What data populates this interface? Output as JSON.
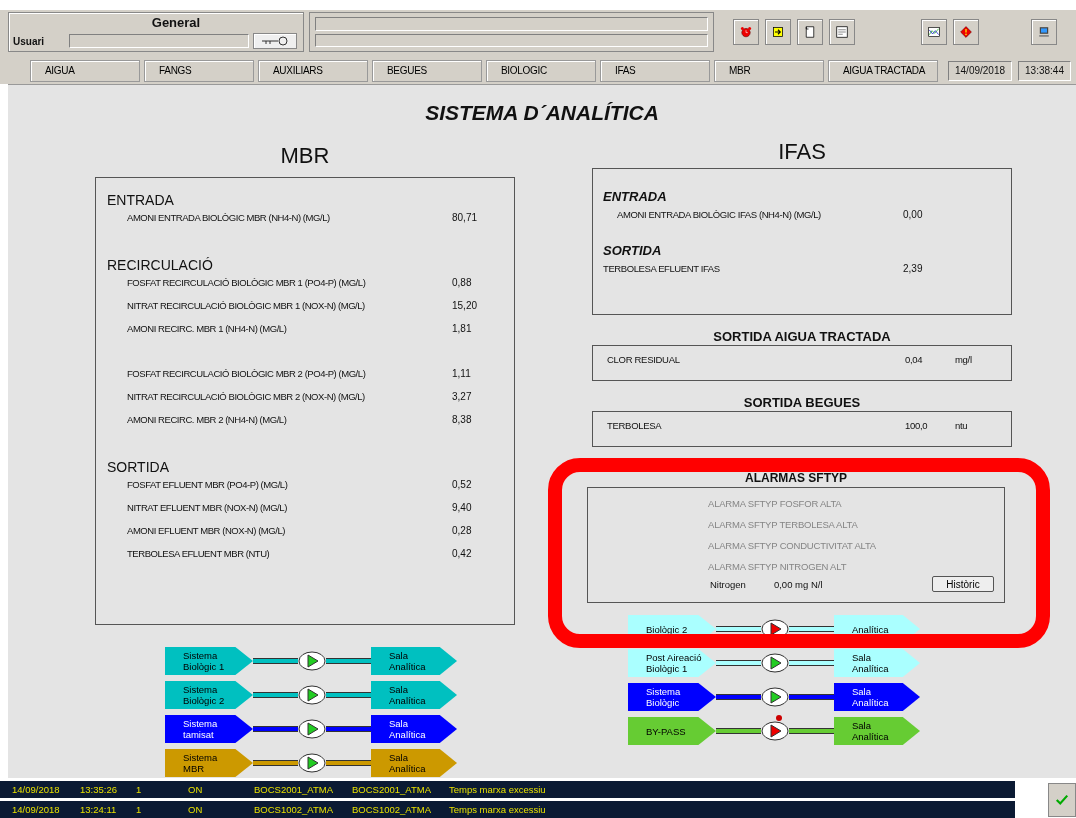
{
  "header": {
    "title": "General",
    "user_label": "Usuari"
  },
  "tabs": [
    {
      "label": "AIGUA",
      "selected": false
    },
    {
      "label": "FANGS",
      "selected": false
    },
    {
      "label": "AUXILIARS",
      "selected": false
    },
    {
      "label": "BEGUES",
      "selected": false
    },
    {
      "label": "BIOLOGIC",
      "selected": false
    },
    {
      "label": "IFAS",
      "selected": false
    },
    {
      "label": "MBR",
      "selected": false
    },
    {
      "label": "AIGUA TRACTADA",
      "selected": false
    }
  ],
  "date": "14/09/2018",
  "time": "13:38:44",
  "page_title": "SISTEMA D´ANALÍTICA",
  "mbr": {
    "title": "MBR",
    "sections": [
      {
        "heading": "ENTRADA",
        "groups": [
          [
            {
              "label": "AMONI ENTRADA BIOLÒGIC MBR (NH4-N) (MG/L)",
              "value": "80,71"
            }
          ]
        ]
      },
      {
        "heading": "RECIRCULACIÓ",
        "groups": [
          [
            {
              "label": "FOSFAT RECIRCULACIÓ BIOLÒGIC MBR 1 (PO4-P) (MG/L)",
              "value": "0,88"
            },
            {
              "label": "NITRAT RECIRCULACIÓ BIOLÒGIC  MBR 1 (NOX-N) (MG/L)",
              "value": "15,20"
            },
            {
              "label": "AMONI RECIRC. MBR 1 (NH4-N) (MG/L)",
              "value": "1,81"
            }
          ],
          [
            {
              "label": "FOSFAT RECIRCULACIÓ BIOLÒGIC MBR 2 (PO4-P) (MG/L)",
              "value": "1,11"
            },
            {
              "label": "NITRAT RECIRCULACIÓ BIOLÒGIC MBR 2 (NOX-N) (MG/L)",
              "value": "3,27"
            },
            {
              "label": "AMONI RECIRC. MBR 2 (NH4-N) (MG/L)",
              "value": "8,38"
            }
          ]
        ]
      },
      {
        "heading": "SORTIDA",
        "groups": [
          [
            {
              "label": "FOSFAT EFLUENT MBR (PO4-P) (MG/L)",
              "value": "0,52"
            },
            {
              "label": "NITRAT EFLUENT MBR (NOX-N) (MG/L)",
              "value": "9,40"
            },
            {
              "label": "AMONI EFLUENT MBR (NOX-N) (MG/L)",
              "value": "0,28"
            },
            {
              "label": "TERBOLESA EFLUENT MBR (NTU)",
              "value": "0,42"
            }
          ]
        ]
      }
    ]
  },
  "ifas": {
    "title": "IFAS",
    "sections": [
      {
        "heading": "ENTRADA",
        "rows": [
          {
            "label": "AMONI ENTRADA BIOLÒGIC IFAS (NH4-N) (MG/L)",
            "value": "0,00"
          }
        ]
      },
      {
        "heading": "SORTIDA",
        "rows": [
          {
            "label": "TERBOLESA EFLUENT IFAS",
            "value": "2,39"
          }
        ]
      }
    ]
  },
  "outputs": [
    {
      "heading": "SORTIDA AIGUA TRACTADA",
      "label": "CLOR RESIDUAL",
      "value": "0,04",
      "unit": "mg/l"
    },
    {
      "heading": "SORTIDA BEGUES",
      "label": "TERBOLESA",
      "value": "100,0",
      "unit": "ntu"
    }
  ],
  "alarms": {
    "title": "ALARMAS SFTYP",
    "items": [
      {
        "label": "ALARMA SFTYP FOSFOR ALTA",
        "active": false
      },
      {
        "label": "ALARMA SFTYP TERBOLESA ALTA",
        "active": false
      },
      {
        "label": "ALARMA SFTYP CONDUCTIVITAT ALTA",
        "active": false
      },
      {
        "label": "ALARMA SFTYP NITROGEN ALT",
        "active": false
      }
    ],
    "reading_label": "Nitrogen",
    "reading": "0,00  mg N/l",
    "button": "Històric"
  },
  "flows_left": [
    {
      "source": "Sistema\nBiològic 1",
      "dest": "Sala\nAnalítica",
      "color": "#00c0c0",
      "running": true,
      "alarm": false
    },
    {
      "source": "Sistema\nBiològic 2",
      "dest": "Sala\nAnalítica",
      "color": "#00c0c0",
      "running": true,
      "alarm": false
    },
    {
      "source": "Sistema\ntamisat",
      "dest": "Sala\nAnalítica",
      "color": "#0000ff",
      "running": true,
      "alarm": false
    },
    {
      "source": "Sistema\nMBR",
      "dest": "Sala\nAnalítica",
      "color": "#cc9900",
      "running": true,
      "alarm": false
    }
  ],
  "flows_right": [
    {
      "source": "Biològic 2",
      "dest": "Analítica",
      "color": "#aaffff",
      "running": false,
      "alarm": false
    },
    {
      "source": "Post Aireació\nBiològic 1",
      "dest": "Sala\nAnalítica",
      "color": "#aaffff",
      "running": true,
      "alarm": false
    },
    {
      "source": "Sistema\nBiològic",
      "dest": "Sala\nAnalítica",
      "color": "#0000ff",
      "running": true,
      "alarm": false
    },
    {
      "source": "BY-PASS",
      "dest": "Sala\nAnalítica",
      "color": "#66cc33",
      "running": false,
      "alarm": true
    }
  ],
  "events": [
    {
      "date": "14/09/2018",
      "time": "13:35:26",
      "count": "1",
      "state": "ON",
      "tag": "BOCS2001_ATMA",
      "tag2": "BOCS2001_ATMA",
      "message": "Temps marxa excessiu"
    },
    {
      "date": "14/09/2018",
      "time": "13:24:11",
      "count": "1",
      "state": "ON",
      "tag": "BOCS1002_ATMA",
      "tag2": "BOCS1002_ATMA",
      "message": "Temps marxa excessiu"
    }
  ]
}
